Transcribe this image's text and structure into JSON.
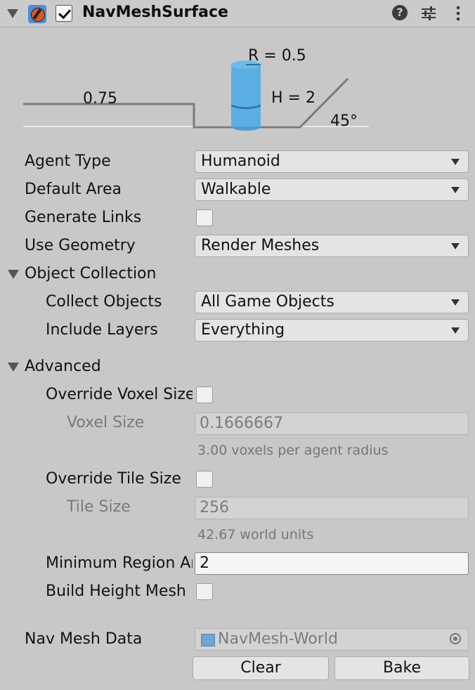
{
  "header": {
    "title": "NavMeshSurface",
    "enabled": true
  },
  "diagram": {
    "radius_label": "R = 0.5",
    "height_label": "H = 2",
    "step_label": "0.75",
    "slope_label": "45°",
    "agent_color": "#5aaee4"
  },
  "fields": {
    "agent_type_label": "Agent Type",
    "agent_type_value": "Humanoid",
    "default_area_label": "Default Area",
    "default_area_value": "Walkable",
    "generate_links_label": "Generate Links",
    "use_geometry_label": "Use Geometry",
    "use_geometry_value": "Render Meshes"
  },
  "object_collection": {
    "label": "Object Collection",
    "collect_objects_label": "Collect Objects",
    "collect_objects_value": "All Game Objects",
    "include_layers_label": "Include Layers",
    "include_layers_value": "Everything"
  },
  "advanced": {
    "label": "Advanced",
    "override_voxel_size_label": "Override Voxel Size",
    "voxel_size_label": "Voxel Size",
    "voxel_size_value": "0.1666667",
    "voxel_help": "3.00 voxels per agent radius",
    "override_tile_size_label": "Override Tile Size",
    "tile_size_label": "Tile Size",
    "tile_size_value": "256",
    "tile_help": "42.67 world units",
    "minimum_region_area_label": "Minimum Region Area",
    "minimum_region_area_value": "2",
    "build_height_mesh_label": "Build Height Mesh"
  },
  "navmesh": {
    "label": "Nav Mesh Data",
    "value": "NavMesh-World",
    "clear_button": "Clear",
    "bake_button": "Bake"
  }
}
